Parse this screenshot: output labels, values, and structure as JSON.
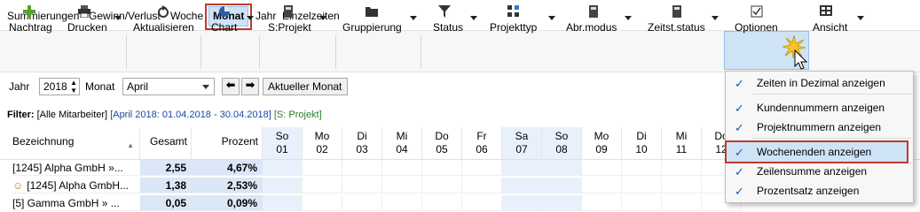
{
  "menu": [
    "Summierungen",
    "Gewinn/Verlust",
    "Woche",
    "Monat",
    "Jahr",
    "Einzelzeiten"
  ],
  "menu_active": "Monat",
  "toolbar": {
    "nachtrag": "Nachtrag",
    "drucken": "Drucken",
    "aktualisieren": "Aktualisieren",
    "chart": "Chart",
    "sprojekt": "S:Projekt",
    "gruppierung": "Gruppierung",
    "status": "Status",
    "projekttyp": "Projekttyp",
    "abrmodus": "Abr.modus",
    "zeitststatus": "Zeitst.status",
    "optionen": "Optionen",
    "ansicht": "Ansicht"
  },
  "period": {
    "jahr_label": "Jahr",
    "jahr_value": "2018",
    "monat_label": "Monat",
    "monat_value": "April",
    "aktueller_monat": "Aktueller Monat"
  },
  "filter": {
    "label": "Filter:",
    "part1": "[Alle Mitarbeiter]",
    "part2": "[April 2018: 01.04.2018 - 30.04.2018]",
    "part3": "[S: Projekt]"
  },
  "grid": {
    "col_bezeichnung": "Bezeichnung",
    "col_gesamt": "Gesamt",
    "col_prozent": "Prozent",
    "days": [
      {
        "d": "So",
        "n": "01"
      },
      {
        "d": "Mo",
        "n": "02"
      },
      {
        "d": "Di",
        "n": "03"
      },
      {
        "d": "Mi",
        "n": "04"
      },
      {
        "d": "Do",
        "n": "05"
      },
      {
        "d": "Fr",
        "n": "06"
      },
      {
        "d": "Sa",
        "n": "07"
      },
      {
        "d": "So",
        "n": "08"
      },
      {
        "d": "Mo",
        "n": "09"
      },
      {
        "d": "Di",
        "n": "10"
      },
      {
        "d": "Mi",
        "n": "11"
      },
      {
        "d": "Do",
        "n": "12"
      }
    ],
    "rows": [
      {
        "name": "[1245] Alpha GmbH »...",
        "gesamt": "2,55",
        "prozent": "4,67%"
      },
      {
        "name": "[1245] Alpha GmbH...",
        "gesamt": "1,38",
        "prozent": "2,53%"
      },
      {
        "name": "[5] Gamma GmbH » ...",
        "gesamt": "0,05",
        "prozent": "0,09%"
      }
    ]
  },
  "options_menu": {
    "items": [
      "Zeiten in Dezimal anzeigen",
      "Kundennummern anzeigen",
      "Projektnummern anzeigen",
      "Wochenenden anzeigen",
      "Zeilensumme anzeigen",
      "Prozentsatz anzeigen"
    ],
    "check": "✓"
  },
  "colors": {
    "highlight_border": "#c0392b",
    "selected_bg": "#cfe3f6",
    "weekend_bg": "#e8f1fb",
    "number_bg": "#dbe6f7"
  }
}
